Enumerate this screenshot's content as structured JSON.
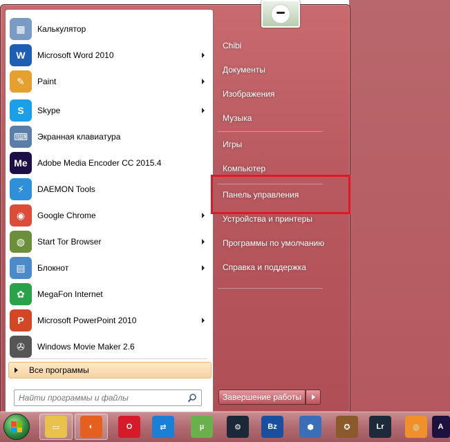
{
  "left_programs": [
    {
      "label": "Калькулятор",
      "icon": "calculator-icon",
      "color": "#7a9cc4",
      "glyph": "▦",
      "has_submenu": false
    },
    {
      "label": "Microsoft Word 2010",
      "icon": "word-icon",
      "color": "#1e5fb4",
      "glyph": "W",
      "has_submenu": true
    },
    {
      "label": "Paint",
      "icon": "paint-palette-icon",
      "color": "#e6a02d",
      "glyph": "✎",
      "has_submenu": true
    },
    {
      "label": "Skype",
      "icon": "skype-icon",
      "color": "#1ba0e8",
      "glyph": "S",
      "has_submenu": true
    },
    {
      "label": "Экранная клавиатура",
      "icon": "keyboard-icon",
      "color": "#5a7ea8",
      "glyph": "⌨",
      "has_submenu": false
    },
    {
      "label": "Adobe Media Encoder CC 2015.4",
      "icon": "adobe-media-encoder-icon",
      "color": "#1c0f45",
      "glyph": "Me",
      "has_submenu": false
    },
    {
      "label": "DAEMON Tools",
      "icon": "daemon-tools-icon",
      "color": "#2f8fd8",
      "glyph": "⚡",
      "has_submenu": false
    },
    {
      "label": "Google Chrome",
      "icon": "chrome-icon",
      "color": "#dd4b39",
      "glyph": "◉",
      "has_submenu": true
    },
    {
      "label": "Start Tor Browser",
      "icon": "tor-browser-icon",
      "color": "#6b8f3a",
      "glyph": "◍",
      "has_submenu": true
    },
    {
      "label": "Блокнот",
      "icon": "notepad-icon",
      "color": "#4c8ac9",
      "glyph": "▤",
      "has_submenu": true
    },
    {
      "label": "MegaFon Internet",
      "icon": "megafon-icon",
      "color": "#2aa24a",
      "glyph": "✿",
      "has_submenu": false
    },
    {
      "label": "Microsoft PowerPoint 2010",
      "icon": "powerpoint-icon",
      "color": "#d24726",
      "glyph": "P",
      "has_submenu": true
    },
    {
      "label": "Windows Movie Maker 2.6",
      "icon": "movie-maker-icon",
      "color": "#555555",
      "glyph": "✇",
      "has_submenu": false
    }
  ],
  "all_programs_label": "Все программы",
  "search": {
    "placeholder": "Найти программы и файлы"
  },
  "right_items": [
    {
      "label": "Chibi",
      "name": "user-folder-link"
    },
    {
      "label": "Документы",
      "name": "documents-link"
    },
    {
      "label": "Изображения",
      "name": "pictures-link"
    },
    {
      "label": "Музыка",
      "name": "music-link"
    },
    {
      "label": "Игры",
      "name": "games-link"
    },
    {
      "label": "Компьютер",
      "name": "computer-link"
    },
    {
      "label": "Панель управления",
      "name": "control-panel-link"
    },
    {
      "label": "Устройства и принтеры",
      "name": "devices-printers-link"
    },
    {
      "label": "Программы по умолчанию",
      "name": "default-programs-link"
    },
    {
      "label": "Справка и поддержка",
      "name": "help-support-link"
    }
  ],
  "shutdown_label": "Завершение работы",
  "highlight_color": "#e0182a",
  "taskbar_items": [
    {
      "icon": "file-explorer-icon",
      "color": "#e8c24a",
      "glyph": "▭"
    },
    {
      "icon": "firefox-icon",
      "color": "#e5601e",
      "glyph": "◐"
    },
    {
      "icon": "opera-icon",
      "color": "#d51b2a",
      "glyph": "O"
    },
    {
      "icon": "teamviewer-icon",
      "color": "#1b7fd6",
      "glyph": "⇄"
    },
    {
      "icon": "utorrent-icon",
      "color": "#6ab04c",
      "glyph": "µ"
    },
    {
      "icon": "steam-icon",
      "color": "#1b2838",
      "glyph": "⚙"
    },
    {
      "icon": "battlenet-icon",
      "color": "#1a4fa0",
      "glyph": "Bz"
    },
    {
      "icon": "heroes-of-the-storm-icon",
      "color": "#3a6fb8",
      "glyph": "⬢"
    },
    {
      "icon": "hearthstone-icon",
      "color": "#8a5a2a",
      "glyph": "✪"
    },
    {
      "icon": "lightroom-icon",
      "color": "#1d2a3a",
      "glyph": "Lr"
    },
    {
      "icon": "overwatch-icon",
      "color": "#f0902a",
      "glyph": "◎"
    },
    {
      "icon": "after-effects-icon",
      "color": "#1c1240",
      "glyph": "A"
    }
  ]
}
